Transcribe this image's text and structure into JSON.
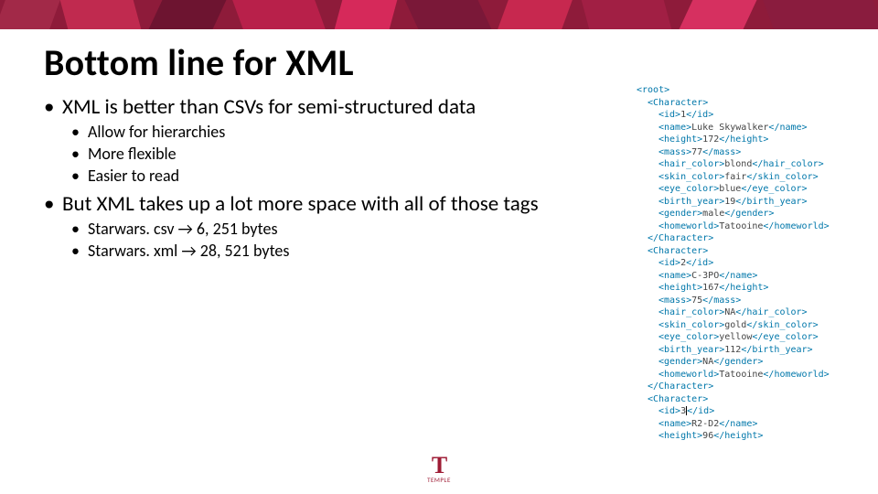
{
  "title": "Bottom line for XML",
  "bullets": {
    "b1": "XML is better than CSVs for semi-structured data",
    "b1_sub": [
      "Allow for hierarchies",
      "More flexible",
      "Easier to read"
    ],
    "b2": "But XML takes up a lot more space with all of those tags",
    "b2_sub": [
      "Starwars. csv → 6, 251 bytes",
      "Starwars. xml → 28, 521 bytes"
    ]
  },
  "xml": {
    "characters": [
      {
        "id": "1",
        "name": "Luke Skywalker",
        "height": "172",
        "mass": "77",
        "hair_color": "blond",
        "skin_color": "fair",
        "eye_color": "blue",
        "birth_year": "19",
        "gender": "male",
        "homeworld": "Tatooine"
      },
      {
        "id": "2",
        "name": "C-3PO",
        "height": "167",
        "mass": "75",
        "hair_color": "NA",
        "skin_color": "gold",
        "eye_color": "yellow",
        "birth_year": "112",
        "gender": "NA",
        "homeworld": "Tatooine"
      },
      {
        "id": "3",
        "name": "R2-D2",
        "height": "96"
      }
    ]
  },
  "footer": {
    "brand": "TEMPLE"
  }
}
